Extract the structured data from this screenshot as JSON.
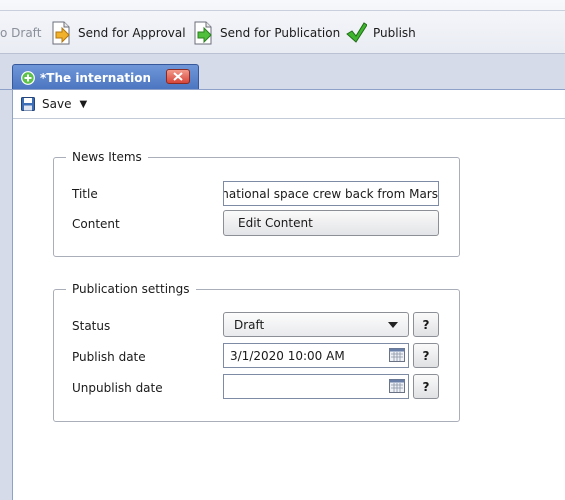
{
  "toolbar": {
    "draft_label": "o Draft",
    "send_approval_label": "Send for Approval",
    "send_publication_label": "Send for Publication",
    "publish_label": "Publish"
  },
  "tab": {
    "title": "*The international sp",
    "icon": "plus-circle-icon"
  },
  "save_bar": {
    "save_label": "Save"
  },
  "news_items": {
    "legend": "News Items",
    "title_label": "Title",
    "title_value": "international space crew back from Mars",
    "content_label": "Content",
    "edit_content_label": "Edit Content"
  },
  "publication": {
    "legend": "Publication settings",
    "status_label": "Status",
    "status_value": "Draft",
    "publish_date_label": "Publish date",
    "publish_date_value": "3/1/2020 10:00 AM",
    "unpublish_date_label": "Unpublish date",
    "unpublish_date_value": "",
    "help_glyph": "?"
  },
  "colors": {
    "tab_active": "#4a74c0",
    "close_button": "#d6453a",
    "background": "#d6dbe9"
  }
}
